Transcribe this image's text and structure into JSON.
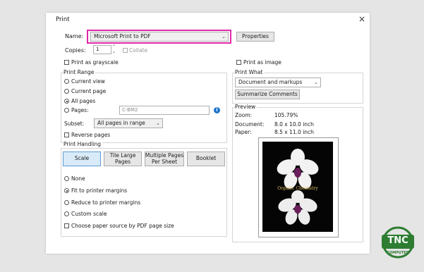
{
  "dialog": {
    "title": "Print",
    "close_glyph": "×"
  },
  "printer": {
    "name_label": "Name:",
    "name_value": "Microsoft Print to PDF",
    "properties_label": "Properties",
    "copies_label": "Copies:",
    "copies_value": "1",
    "collate_label": "Collate"
  },
  "options": {
    "grayscale_label": "Print as grayscale",
    "image_label": "Print as image"
  },
  "print_range": {
    "title": "Print Range",
    "current_view": "Current view",
    "current_page": "Current page",
    "all_pages": "All pages",
    "pages": "Pages:",
    "pages_value": "C-BM2",
    "subset_label": "Subset:",
    "subset_value": "All pages in range",
    "reverse_label": "Reverse pages",
    "selected": "all_pages"
  },
  "print_what": {
    "title": "Print What",
    "value": "Document and markups",
    "summarize_label": "Summarize Comments"
  },
  "print_handling": {
    "title": "Print Handling",
    "buttons": {
      "scale": "Scale",
      "tile": "Tile Large\nPages",
      "multiple": "Multiple Pages\nPer Sheet",
      "booklet": "Booklet"
    },
    "none": "None",
    "fit": "Fit to printer margins",
    "reduce": "Reduce to printer margins",
    "custom": "Custom scale",
    "paper_source": "Choose paper source by PDF page size",
    "selected": "fit"
  },
  "preview": {
    "title": "Preview",
    "zoom_label": "Zoom:",
    "zoom_value": "105.79%",
    "document_label": "Document:",
    "document_value": "8.0 x 10.0 inch",
    "paper_label": "Paper:",
    "paper_value": "8.5 x 11.0 inch",
    "book_title": "Organic Chemistry"
  },
  "watermark": {
    "text": "TNC",
    "subtext": "COMPUTER"
  },
  "colors": {
    "highlight": "#e02aa8",
    "accent": "#2e7d32",
    "scale_active": "#d9ebf9"
  }
}
